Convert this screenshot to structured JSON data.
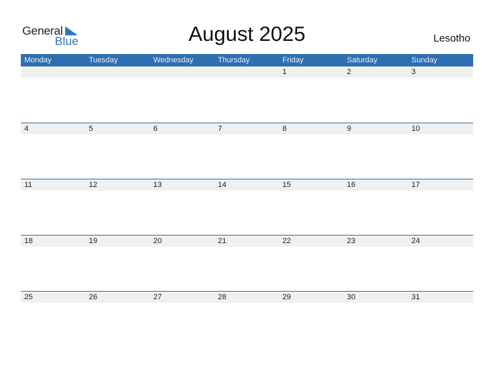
{
  "logo": {
    "word1": "General",
    "word2": "Blue"
  },
  "title": "August 2025",
  "country": "Lesotho",
  "weekdays": [
    "Monday",
    "Tuesday",
    "Wednesday",
    "Thursday",
    "Friday",
    "Saturday",
    "Sunday"
  ],
  "weeks": [
    [
      "",
      "",
      "",
      "",
      "1",
      "2",
      "3"
    ],
    [
      "4",
      "5",
      "6",
      "7",
      "8",
      "9",
      "10"
    ],
    [
      "11",
      "12",
      "13",
      "14",
      "15",
      "16",
      "17"
    ],
    [
      "18",
      "19",
      "20",
      "21",
      "22",
      "23",
      "24"
    ],
    [
      "25",
      "26",
      "27",
      "28",
      "29",
      "30",
      "31"
    ]
  ],
  "colors": {
    "accent": "#2e6fb1",
    "logo_blue": "#2a76c6",
    "strip": "#f0f0f0"
  }
}
